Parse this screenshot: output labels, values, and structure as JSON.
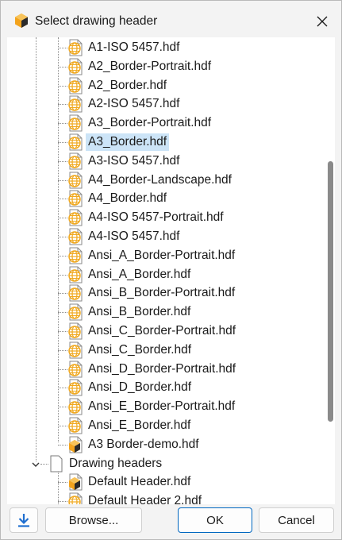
{
  "window": {
    "title": "Select drawing header",
    "app_icon": "app-logo-icon",
    "close_icon": "close-icon"
  },
  "tree": {
    "items": [
      {
        "label": "A1-ISO 5457.hdf",
        "icon": "globe-file-icon",
        "selected": false
      },
      {
        "label": "A2_Border-Portrait.hdf",
        "icon": "globe-file-icon",
        "selected": false
      },
      {
        "label": "A2_Border.hdf",
        "icon": "globe-file-icon",
        "selected": false
      },
      {
        "label": "A2-ISO 5457.hdf",
        "icon": "globe-file-icon",
        "selected": false
      },
      {
        "label": "A3_Border-Portrait.hdf",
        "icon": "globe-file-icon",
        "selected": false
      },
      {
        "label": "A3_Border.hdf",
        "icon": "globe-file-icon",
        "selected": true
      },
      {
        "label": "A3-ISO 5457.hdf",
        "icon": "globe-file-icon",
        "selected": false
      },
      {
        "label": "A4_Border-Landscape.hdf",
        "icon": "globe-file-icon",
        "selected": false
      },
      {
        "label": "A4_Border.hdf",
        "icon": "globe-file-icon",
        "selected": false
      },
      {
        "label": "A4-ISO 5457-Portrait.hdf",
        "icon": "globe-file-icon",
        "selected": false
      },
      {
        "label": "A4-ISO 5457.hdf",
        "icon": "globe-file-icon",
        "selected": false
      },
      {
        "label": "Ansi_A_Border-Portrait.hdf",
        "icon": "globe-file-icon",
        "selected": false
      },
      {
        "label": "Ansi_A_Border.hdf",
        "icon": "globe-file-icon",
        "selected": false
      },
      {
        "label": "Ansi_B_Border-Portrait.hdf",
        "icon": "globe-file-icon",
        "selected": false
      },
      {
        "label": "Ansi_B_Border.hdf",
        "icon": "globe-file-icon",
        "selected": false
      },
      {
        "label": "Ansi_C_Border-Portrait.hdf",
        "icon": "globe-file-icon",
        "selected": false
      },
      {
        "label": "Ansi_C_Border.hdf",
        "icon": "globe-file-icon",
        "selected": false
      },
      {
        "label": "Ansi_D_Border-Portrait.hdf",
        "icon": "globe-file-icon",
        "selected": false
      },
      {
        "label": "Ansi_D_Border.hdf",
        "icon": "globe-file-icon",
        "selected": false
      },
      {
        "label": "Ansi_E_Border-Portrait.hdf",
        "icon": "globe-file-icon",
        "selected": false
      },
      {
        "label": "Ansi_E_Border.hdf",
        "icon": "globe-file-icon",
        "selected": false
      },
      {
        "label": "A3 Border-demo.hdf",
        "icon": "hex-file-icon",
        "selected": false
      }
    ],
    "folder": {
      "label": "Drawing headers",
      "icon": "folder-icon",
      "expand_icon": "chevron-down-icon",
      "expanded": true
    },
    "folder_items": [
      {
        "label": "Default Header.hdf",
        "icon": "hex-file-icon"
      },
      {
        "label": "Default Header 2.hdf",
        "icon": "globe-file-icon"
      }
    ]
  },
  "footer": {
    "download_icon": "download-icon",
    "browse_label": "Browse...",
    "ok_label": "OK",
    "cancel_label": "Cancel"
  },
  "colors": {
    "accent": "#0067c0",
    "selection": "#cce4f7",
    "globe_orange": "#f0a81e",
    "hex_orange": "#f08a1e",
    "download_blue": "#1f6fd0"
  }
}
